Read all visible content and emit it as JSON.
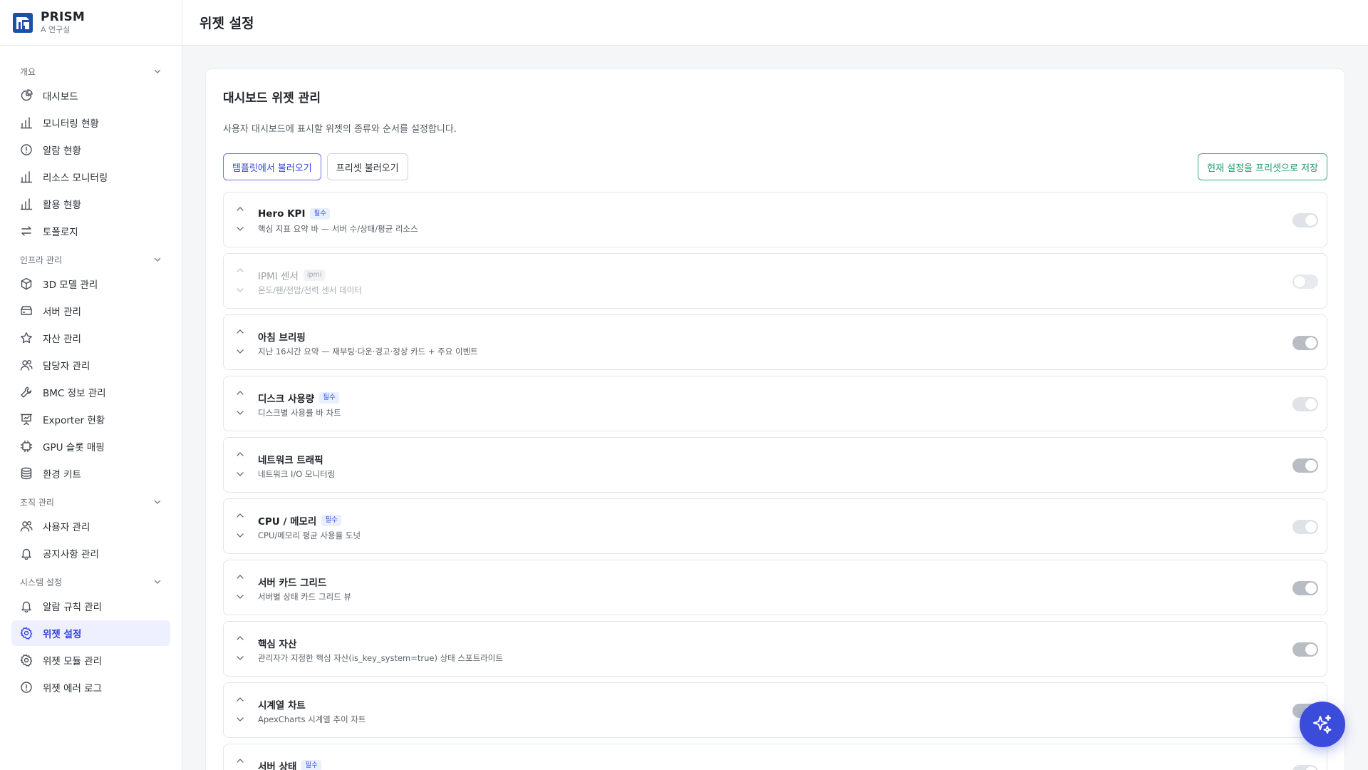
{
  "brand": {
    "name": "PRISM",
    "sub": "A 연구실"
  },
  "page": {
    "title": "위젯 설정"
  },
  "sidebar": {
    "groups": [
      {
        "label": "개요",
        "items": [
          {
            "label": "대시보드",
            "icon": "pie-chart-icon"
          },
          {
            "label": "모니터링 현황",
            "icon": "bar-chart-icon"
          },
          {
            "label": "알람 현황",
            "icon": "alert-circle-icon"
          },
          {
            "label": "리소스 모니터링",
            "icon": "bar-chart-icon"
          },
          {
            "label": "활용 현황",
            "icon": "bar-chart-icon"
          },
          {
            "label": "토폴로지",
            "icon": "arrows-exchange-icon"
          }
        ]
      },
      {
        "label": "인프라 관리",
        "items": [
          {
            "label": "3D 모델 관리",
            "icon": "cube-icon"
          },
          {
            "label": "서버 관리",
            "icon": "server-icon"
          },
          {
            "label": "자산 관리",
            "icon": "star-icon"
          },
          {
            "label": "담당자 관리",
            "icon": "users-icon"
          },
          {
            "label": "BMC 정보 관리",
            "icon": "wrench-icon"
          },
          {
            "label": "Exporter 현황",
            "icon": "presentation-icon"
          },
          {
            "label": "GPU 슬롯 매핑",
            "icon": "chip-icon"
          },
          {
            "label": "환경 키트",
            "icon": "database-icon"
          }
        ]
      },
      {
        "label": "조직 관리",
        "items": [
          {
            "label": "사용자 관리",
            "icon": "users-icon"
          },
          {
            "label": "공지사항 관리",
            "icon": "bell-icon"
          }
        ]
      },
      {
        "label": "시스템 설정",
        "items": [
          {
            "label": "알람 규칙 관리",
            "icon": "bell-icon"
          },
          {
            "label": "위젯 설정",
            "icon": "gear-icon",
            "active": true
          },
          {
            "label": "위젯 모듈 관리",
            "icon": "gear-icon"
          },
          {
            "label": "위젯 에러 로그",
            "icon": "alert-circle-icon"
          }
        ]
      }
    ]
  },
  "card": {
    "title": "대시보드 위젯 관리",
    "desc": "사용자 대시보드에 표시할 위젯의 종류와 순서를 설정합니다.",
    "buttons": {
      "template": "템플릿에서 불러오기",
      "preset": "프리셋 불러오기",
      "save_preset": "현재 설정을 프리셋으로 저장"
    }
  },
  "widgets": [
    {
      "title": "Hero KPI",
      "badge": "필수",
      "desc": "핵심 지표 요약 바 — 서버 수/상태/평균 리소스",
      "state": "locked"
    },
    {
      "title": "IPMI 센서",
      "badge": "ipmi",
      "desc": "온도/팬/전압/전력 센서 데이터",
      "state": "off",
      "disabled": true
    },
    {
      "title": "아침 브리핑",
      "badge": "",
      "desc": "지난 16시간 요약 — 재부팅·다운·경고·정상 카드 + 주요 이벤트",
      "state": "on"
    },
    {
      "title": "디스크 사용량",
      "badge": "필수",
      "desc": "디스크별 사용률 바 차트",
      "state": "locked"
    },
    {
      "title": "네트워크 트래픽",
      "badge": "",
      "desc": "네트워크 I/O 모니터링",
      "state": "on"
    },
    {
      "title": "CPU / 메모리",
      "badge": "필수",
      "desc": "CPU/메모리 평균 사용률 도넛",
      "state": "locked"
    },
    {
      "title": "서버 카드 그리드",
      "badge": "",
      "desc": "서버별 상태 카드 그리드 뷰",
      "state": "on"
    },
    {
      "title": "핵심 자산",
      "badge": "",
      "desc": "관리자가 지정한 핵심 자산(is_key_system=true) 상태 스포트라이트",
      "state": "on"
    },
    {
      "title": "시계열 차트",
      "badge": "",
      "desc": "ApexCharts 시계열 추이 차트",
      "state": "on"
    },
    {
      "title": "서버 상태",
      "badge": "필수",
      "desc": "",
      "state": "locked"
    }
  ],
  "fab": {
    "icon": "sparkle-icon"
  },
  "colors": {
    "accent": "#3442d9",
    "success": "#1f9a6a",
    "fab": "#3b4cdb"
  }
}
